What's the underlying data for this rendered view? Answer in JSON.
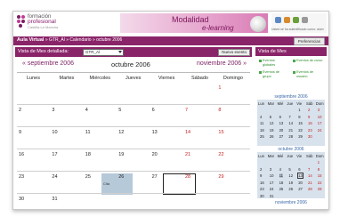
{
  "header": {
    "logo": {
      "line1": "formación",
      "line2": "profesional",
      "line3": "Castilla-La Mancha"
    },
    "banner": {
      "title": "Modalidad",
      "subtitle": "e-learning"
    },
    "user_text": "Usted se ha autentificado como: alum"
  },
  "nav": {
    "root": "Aula Virtual",
    "course": "GTR_Al",
    "section": "Calendario",
    "page": "octubre 2006",
    "preferences_label": "Preferencias"
  },
  "main": {
    "title": "Vista de Mes detallada:",
    "course_select": "GTR_Al",
    "new_event_label": "Nuevo evento",
    "prev_month": "« septiembre 2006",
    "current_month": "octubre 2006",
    "next_month": "noviembre 2006 »",
    "weekdays": [
      "Lunes",
      "Martes",
      "Miércoles",
      "Jueves",
      "Viernes",
      "Sábado",
      "Domingo"
    ],
    "weeks": [
      [
        "",
        "",
        "",
        "",
        "",
        "",
        "1"
      ],
      [
        "2",
        "3",
        "4",
        "5",
        "6",
        "7",
        "8"
      ],
      [
        "9",
        "10",
        "11",
        "12",
        "13",
        "14",
        "15"
      ],
      [
        "16",
        "17",
        "18",
        "19",
        "20",
        "21",
        "22"
      ],
      [
        "23",
        "24",
        "25",
        "26",
        "27",
        "28",
        "29"
      ],
      [
        "30",
        "31",
        "",
        "",
        "",
        "",
        ""
      ]
    ],
    "event_text": "Cita"
  },
  "sidebar": {
    "title": "Vista de Mes",
    "legend": [
      "Eventos globales",
      "Eventos de curso",
      "Eventos de grupo",
      "Eventos de usuario"
    ],
    "mini_weekdays": [
      "Lun",
      "Mar",
      "Mié",
      "Jue",
      "Vie",
      "Sáb",
      "Dom"
    ],
    "mini_months": [
      {
        "name": "septiembre 2006",
        "weeks": [
          [
            "",
            "",
            "",
            "",
            "1",
            "2",
            "3"
          ],
          [
            "4",
            "5",
            "6",
            "7",
            "8",
            "9",
            "10"
          ],
          [
            "11",
            "12",
            "13",
            "14",
            "15",
            "16",
            "17"
          ],
          [
            "18",
            "19",
            "20",
            "21",
            "22",
            "23",
            "24"
          ],
          [
            "25",
            "26",
            "27",
            "28",
            "29",
            "30",
            ""
          ]
        ]
      },
      {
        "name": "octubre 2006",
        "weeks": [
          [
            "",
            "",
            "",
            "",
            "",
            "",
            "1"
          ],
          [
            "2",
            "3",
            "4",
            "5",
            "6",
            "7",
            "8"
          ],
          [
            "9",
            "10",
            "11",
            "12",
            "13",
            "14",
            "15"
          ],
          [
            "16",
            "17",
            "18",
            "19",
            "20",
            "21",
            "22"
          ],
          [
            "23",
            "24",
            "25",
            "26",
            "27",
            "28",
            "29"
          ],
          [
            "30",
            "31",
            "",
            "",
            "",
            "",
            ""
          ]
        ]
      }
    ],
    "next_mini": "noviembre 2006"
  },
  "colors": {
    "accent": "#8a2469",
    "weekend": "#c42020",
    "event": "#b6c9d9",
    "link": "#3a6aa8"
  }
}
